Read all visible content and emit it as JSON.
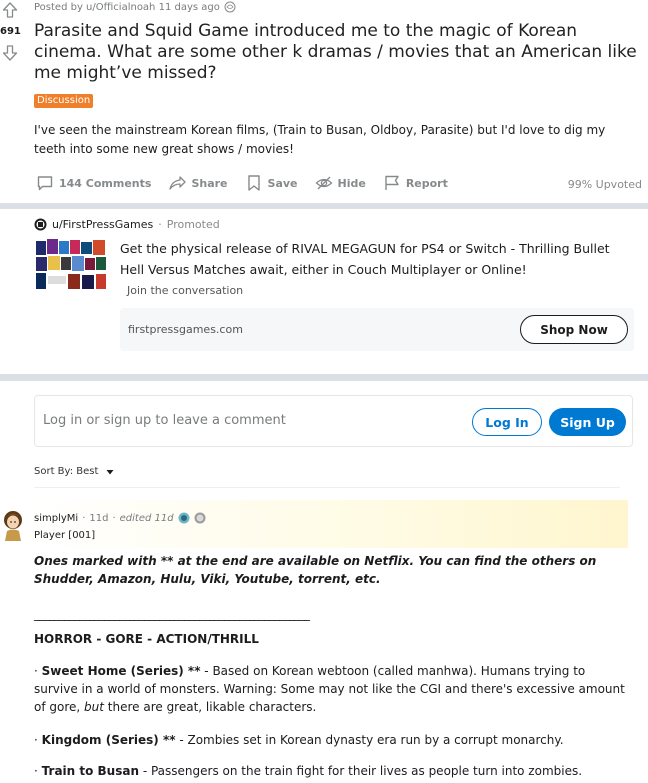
{
  "post": {
    "score": "691",
    "meta": "Posted by u/Officialnoah 11 days ago",
    "title": "Parasite and Squid Game introduced me to the magic of Korean cinema. What are some other k dramas / movies that an American like me might’ve missed?",
    "flair": "Discussion",
    "body": "I've seen the mainstream Korean films, (Train to Busan, Oldboy, Parasite) but I'd love to dig my teeth into some new great shows / movies!",
    "actions": {
      "comments": "144 Comments",
      "share": "Share",
      "save": "Save",
      "hide": "Hide",
      "report": "Report"
    },
    "upvoted": "99% Upvoted"
  },
  "promo": {
    "user": "u/FirstPressGames",
    "separator": "·",
    "promoted": "Promoted",
    "text": "Get the physical release of RIVAL MEGAGUN for PS4 or Switch - Thrilling Bullet Hell Versus Matches await, either in Couch Multiplayer or Online!",
    "join": "Join the conversation",
    "domain": "firstpressgames.com",
    "cta": "Shop Now"
  },
  "login": {
    "prompt": "Log in or sign up to leave a comment",
    "login_label": "Log In",
    "signup_label": "Sign Up"
  },
  "sort": {
    "label": "Sort By: Best"
  },
  "comment": {
    "author": "simplyMi",
    "sep1": "·",
    "age": "11d",
    "sep2": "·",
    "edited": "edited 11d",
    "flair": "Player [001]",
    "intro": "Ones marked with ** at the end are available on Netflix. You can find the others on Shudder, Amazon, Hulu, Viki, Youtube, torrent, etc.",
    "rule": "_______________________________________________________",
    "heading": "HORROR - GORE - ACTION/THRILL",
    "items": [
      {
        "bullet": "·",
        "title": "Sweet Home (Series) **",
        "text": " - Based on Korean webtoon (called manhwa). Humans trying to survive in a world of monsters. Warning: Some may not like the CGI and there's excessive amount of gore, ",
        "emph": "but",
        "tail": " there are great, likable characters."
      },
      {
        "bullet": "·",
        "title": "Kingdom (Series) **",
        "text": " - Zombies set in Korean dynasty era run by a corrupt monarchy."
      },
      {
        "bullet": "·",
        "title": "Train to Busan",
        "text": " - Passengers on the train fight for their lives as people turn into zombies."
      }
    ]
  },
  "colors": {
    "flair": "#ef7f2a",
    "accent": "#0079d3",
    "divider": "#dae0e6",
    "meta": "#878a8c"
  },
  "icons": {
    "upvote": "arrow-up-icon",
    "downvote": "arrow-down-icon",
    "comments": "comment-icon",
    "share": "share-icon",
    "save": "bookmark-icon",
    "hide": "eye-slash-icon",
    "report": "flag-icon"
  }
}
